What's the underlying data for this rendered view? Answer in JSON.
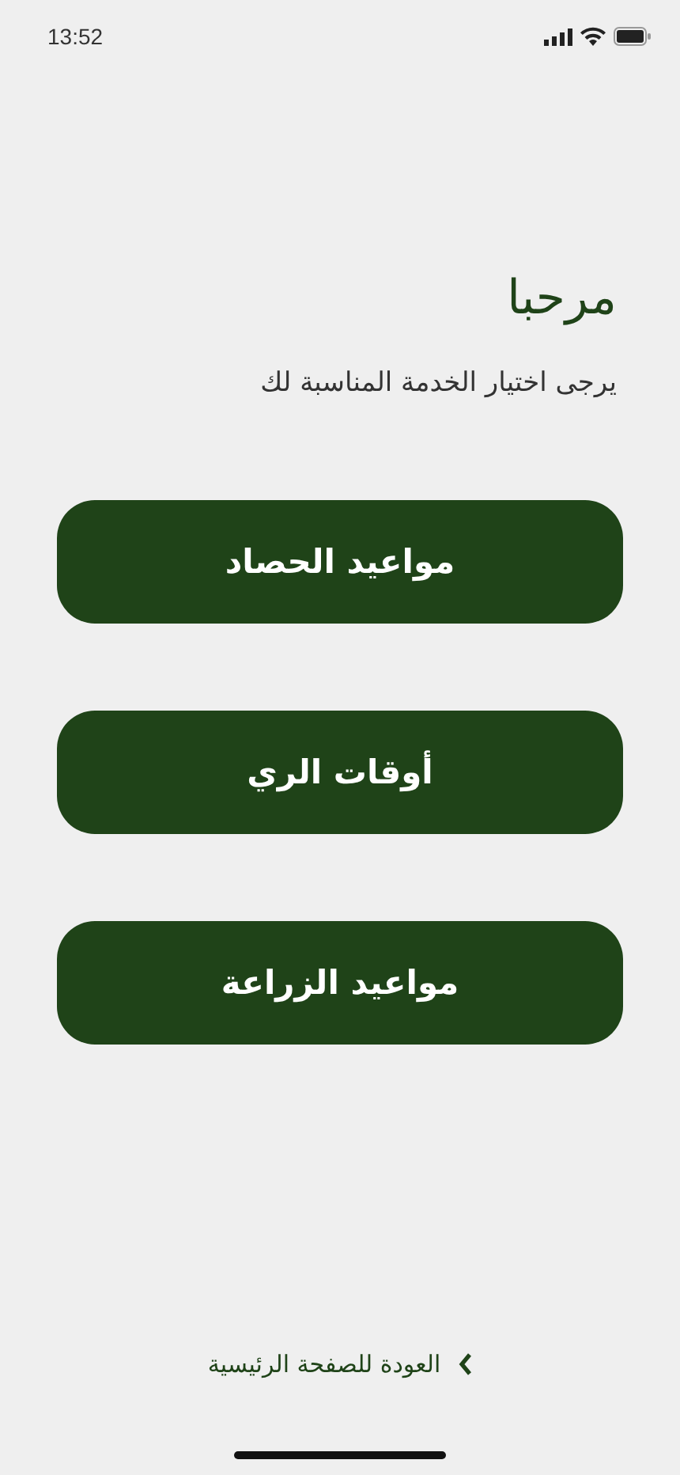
{
  "status_bar": {
    "time": "13:52"
  },
  "title": "مرحبا",
  "subtitle": "يرجى اختيار الخدمة المناسبة لك",
  "services": [
    {
      "label": "مواعيد الحصاد"
    },
    {
      "label": "أوقات الري"
    },
    {
      "label": "مواعيد الزراعة"
    }
  ],
  "back_link": {
    "label": "العودة للصفحة الرئيسية"
  }
}
